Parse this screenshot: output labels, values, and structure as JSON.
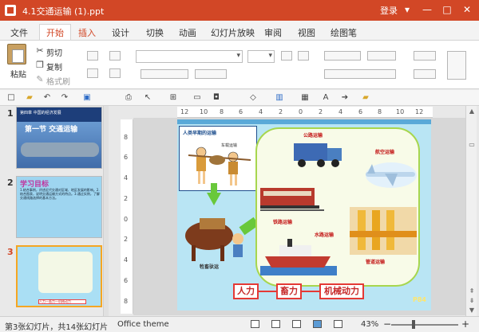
{
  "window": {
    "title": "4.1交通运输 (1).ppt",
    "login": "登录",
    "controls": [
      "▾",
      "—",
      "□",
      "✕"
    ]
  },
  "menu_tabs": [
    "文件",
    "开始",
    "插入",
    "设计",
    "切换",
    "动画",
    "幻灯片放映",
    "审阅",
    "视图",
    "绘图笔"
  ],
  "ribbon": {
    "paste": "粘贴",
    "cut": "剪切",
    "copy": "复制",
    "format_painter": "格式刷"
  },
  "quick_access_icons": [
    "new-icon",
    "open-icon",
    "undo-icon",
    "redo-icon",
    "save-icon",
    "print-icon",
    "cursor-icon",
    "table-icon",
    "image-icon",
    "camera-icon",
    "shape-icon",
    "chart-icon",
    "grid-icon",
    "text-icon",
    "arrow-icon",
    "folder-icon"
  ],
  "thumbnails": [
    {
      "number": "1",
      "title": "第一节 交通运输",
      "subtitle": "第四章 中国的经济发展"
    },
    {
      "number": "2",
      "title": "学习目标",
      "text": "1.结合事例，评述近代交通对区域、地区发展的影响。2.结合图表，说明交通运输方式的特点。3.通过实例，了解交通线路选择的基本方法。"
    },
    {
      "number": "3",
      "caption": "人力—畜力—机械动力"
    }
  ],
  "ruler": {
    "h": [
      "12",
      "10",
      "8",
      "6",
      "4",
      "2",
      "0",
      "2",
      "4",
      "6",
      "8",
      "10",
      "12"
    ],
    "v": [
      "8",
      "6",
      "4",
      "2",
      "0",
      "2",
      "4",
      "6",
      "8"
    ]
  },
  "slide": {
    "panel_title": "人类早期的运输",
    "small_caption": "车载运输",
    "captions": {
      "road": "公路运输",
      "air": "航空运输",
      "rail": "铁路运输",
      "water": "水路运输",
      "pipe": "管道运输",
      "animal": "牲畜驮运"
    },
    "labels": [
      "人力",
      "畜力",
      "机械动力"
    ],
    "page": "P84"
  },
  "colors": {
    "brand": "#d24726",
    "label": "#e53935",
    "slide_bg": "#b9e5f4",
    "bubble_border": "#a7d64e"
  },
  "status": {
    "slide_info": "第3张幻灯片，共14张幻灯片",
    "theme": "Office theme",
    "zoom": "43%",
    "minus": "−",
    "plus": "+"
  }
}
